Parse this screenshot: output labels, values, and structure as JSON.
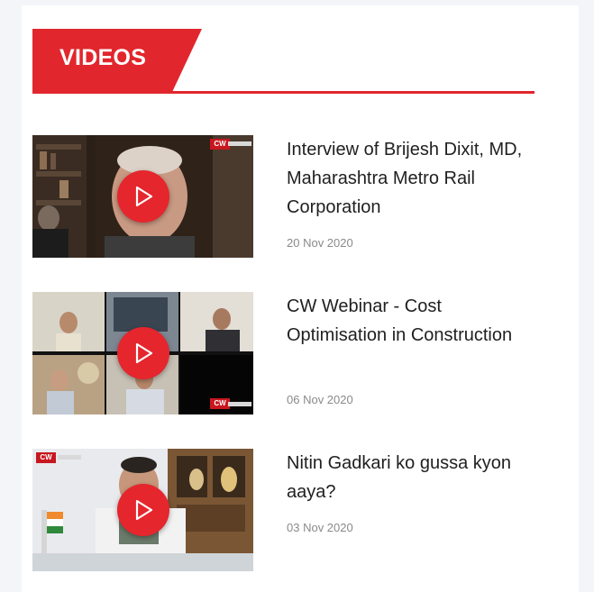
{
  "section": {
    "title": "VIDEOS",
    "accent_color": "#e2262d"
  },
  "videos": [
    {
      "title": "Interview of Brijesh Dixit, MD, Maharashtra Metro Rail Corporation",
      "date": "20 Nov 2020",
      "channel_badge": "CW"
    },
    {
      "title": "CW Webinar - Cost Optimisation in Construction",
      "date": "06 Nov 2020",
      "channel_badge": "CW"
    },
    {
      "title": "Nitin Gadkari ko gussa kyon aaya?",
      "date": "03 Nov 2020",
      "channel_badge": "CW"
    }
  ],
  "icons": {
    "play": "play-icon"
  }
}
